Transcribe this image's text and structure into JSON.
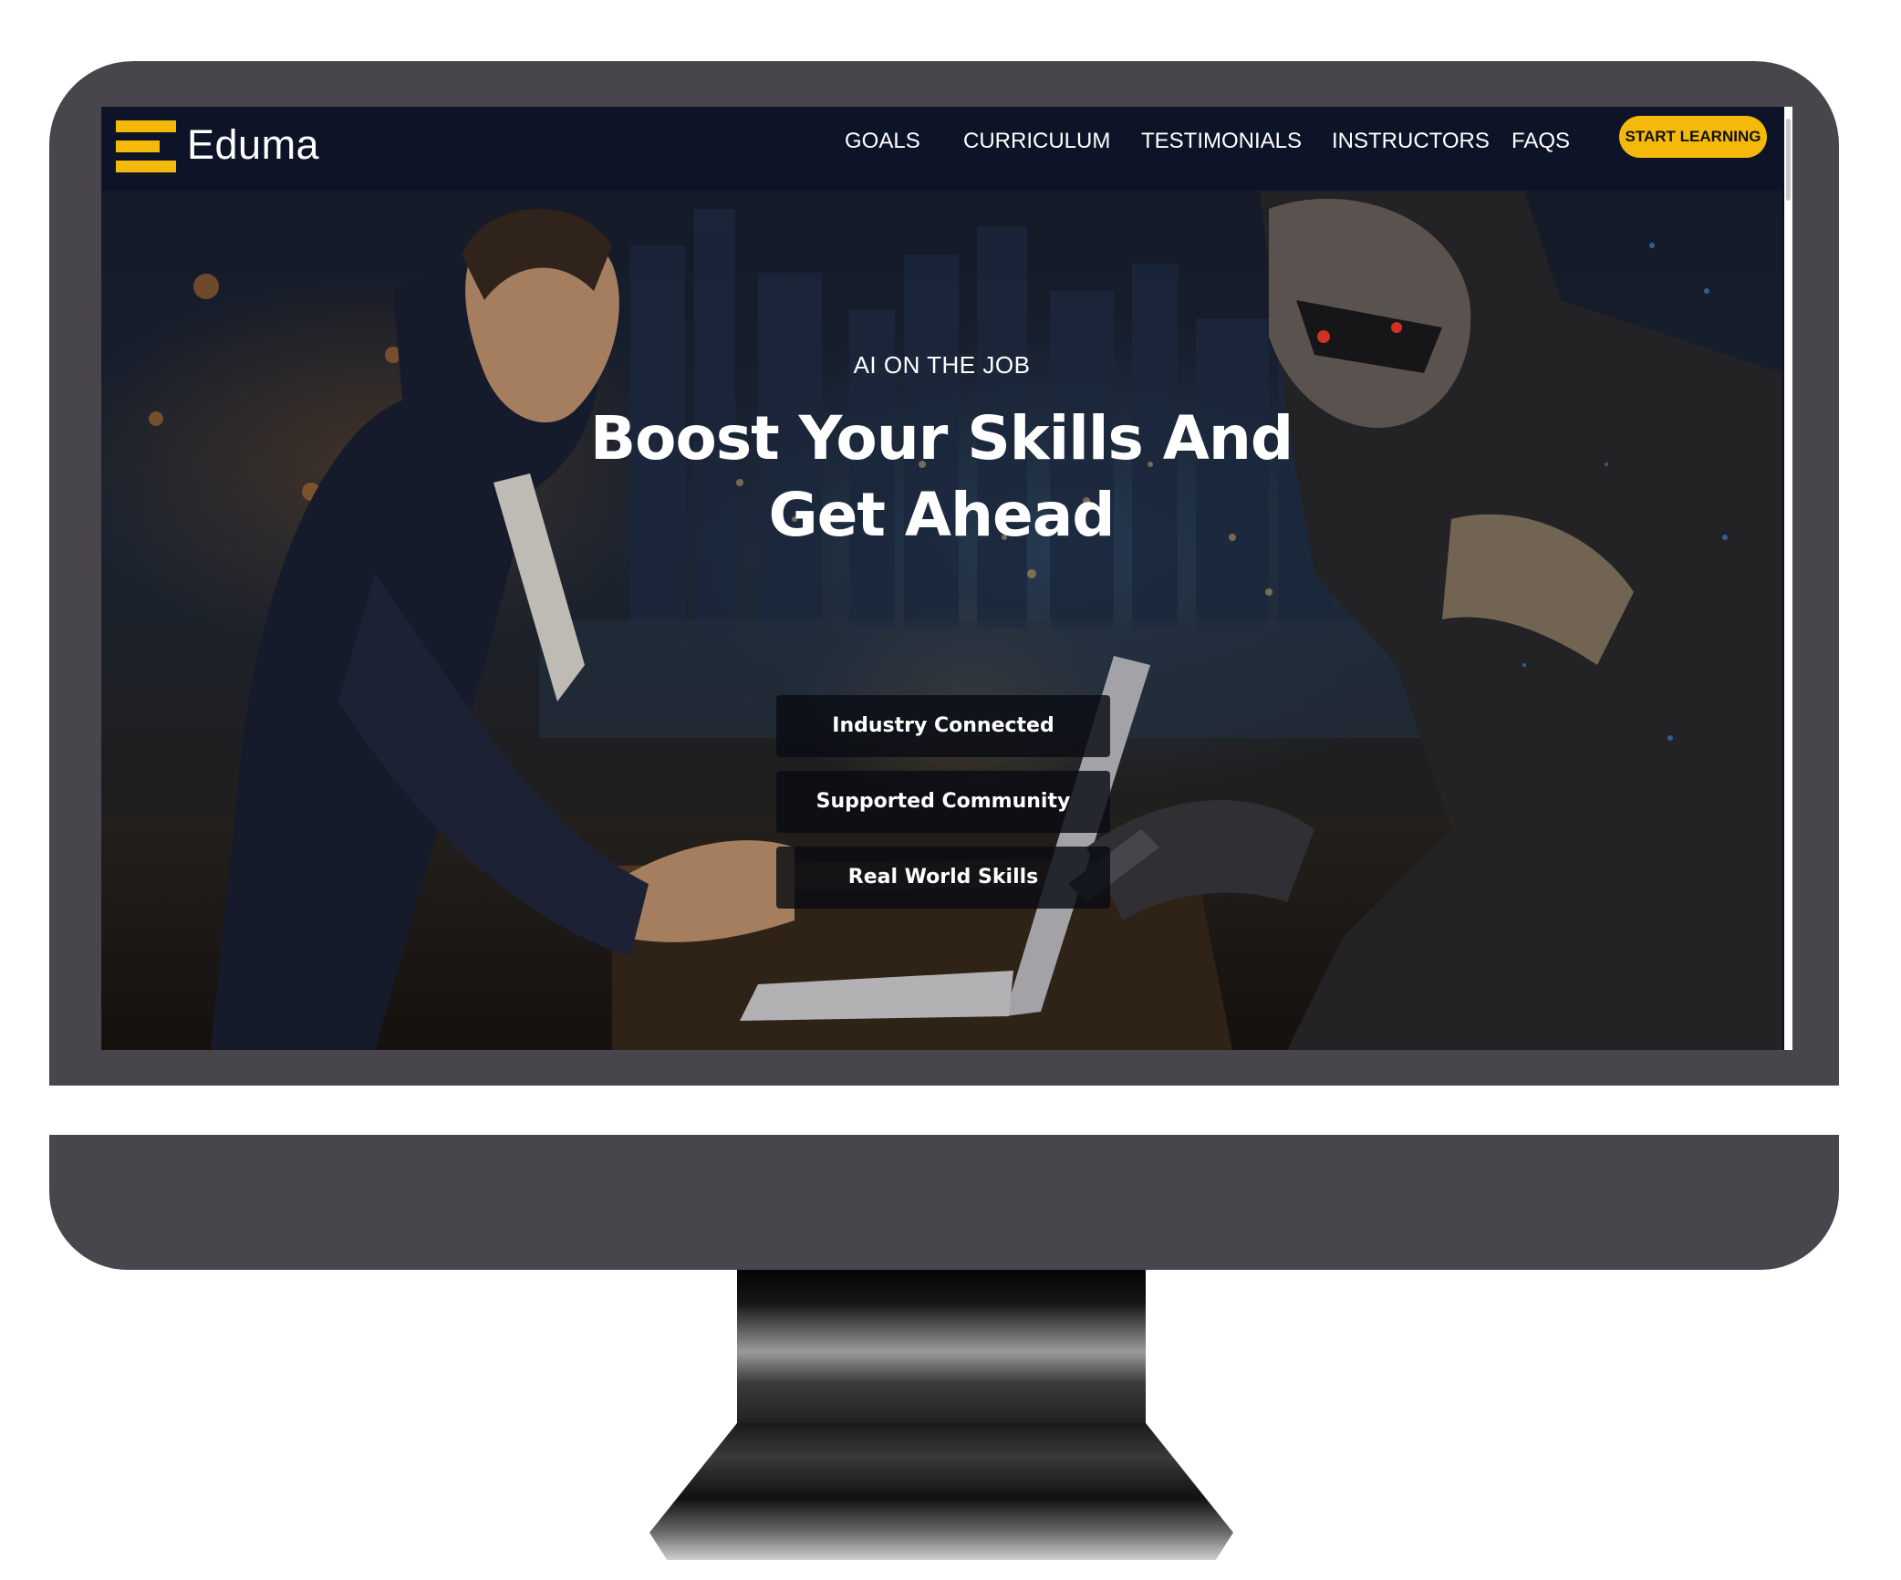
{
  "brand": {
    "name": "Eduma",
    "accent_color": "#f5b90b",
    "nav_bg": "#0e1428"
  },
  "nav": {
    "items": [
      {
        "label": "GOALS"
      },
      {
        "label": "CURRICULUM"
      },
      {
        "label": "TESTIMONIALS"
      },
      {
        "label": "INSTRUCTORS"
      },
      {
        "label": "FAQS"
      }
    ],
    "cta_label": "START LEARNING"
  },
  "hero": {
    "eyebrow": "AI ON THE JOB",
    "title": "Boost Your Skills And Get Ahead",
    "features": [
      {
        "label": "Industry Connected"
      },
      {
        "label": "Supported Community"
      },
      {
        "label": "Real World Skills"
      }
    ],
    "image": {
      "left_subject": "man-in-suit-typing-on-laptop",
      "right_subject": "humanoid-robot-typing",
      "background": "night-city-skyline-by-water"
    }
  },
  "icons": {
    "logo": "stacked-bars-logo-icon"
  }
}
